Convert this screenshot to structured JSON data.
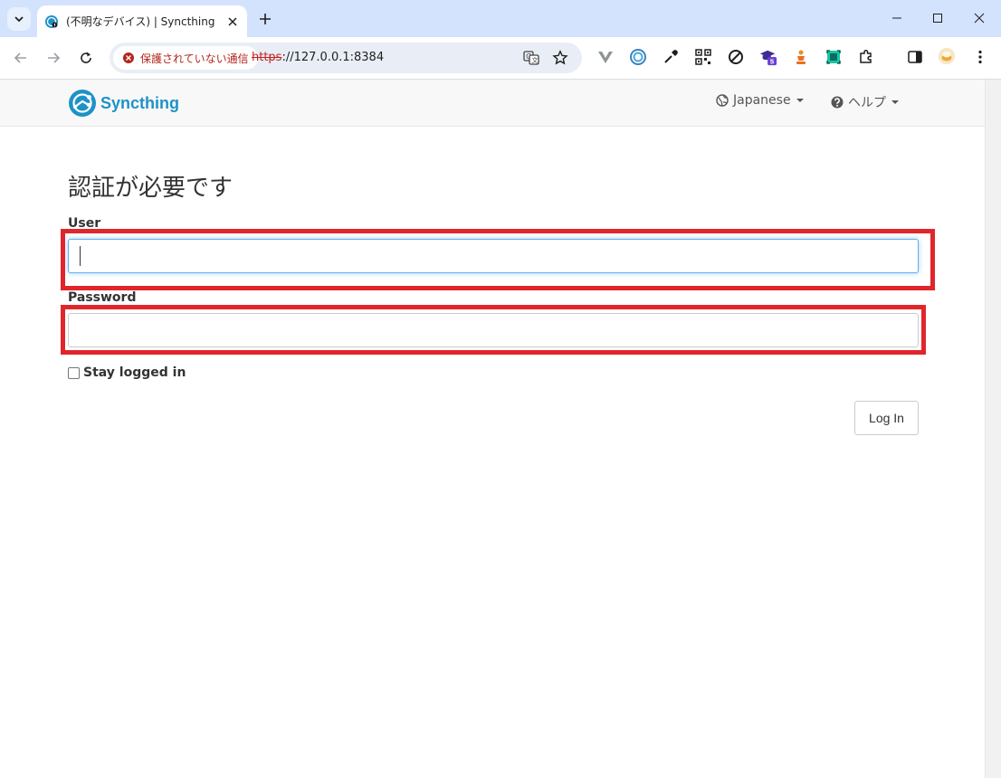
{
  "browser": {
    "tab_title": "(不明なデバイス) | Syncthing",
    "security_label": "保護されていない通信",
    "url_scheme": "https",
    "url_rest": "://127.0.0.1:8384",
    "extension_badge": "5"
  },
  "navbar": {
    "brand": "Syncthing",
    "language": "Japanese",
    "help": "ヘルプ"
  },
  "login": {
    "heading": "認証が必要です",
    "user_label": "User",
    "user_value": "",
    "password_label": "Password",
    "password_value": "",
    "stay_logged_in": "Stay logged in",
    "login_button": "Log In"
  },
  "colors": {
    "highlight": "#e0262b",
    "brand": "#1e92c7",
    "tab_bar": "#d3e3fd"
  }
}
